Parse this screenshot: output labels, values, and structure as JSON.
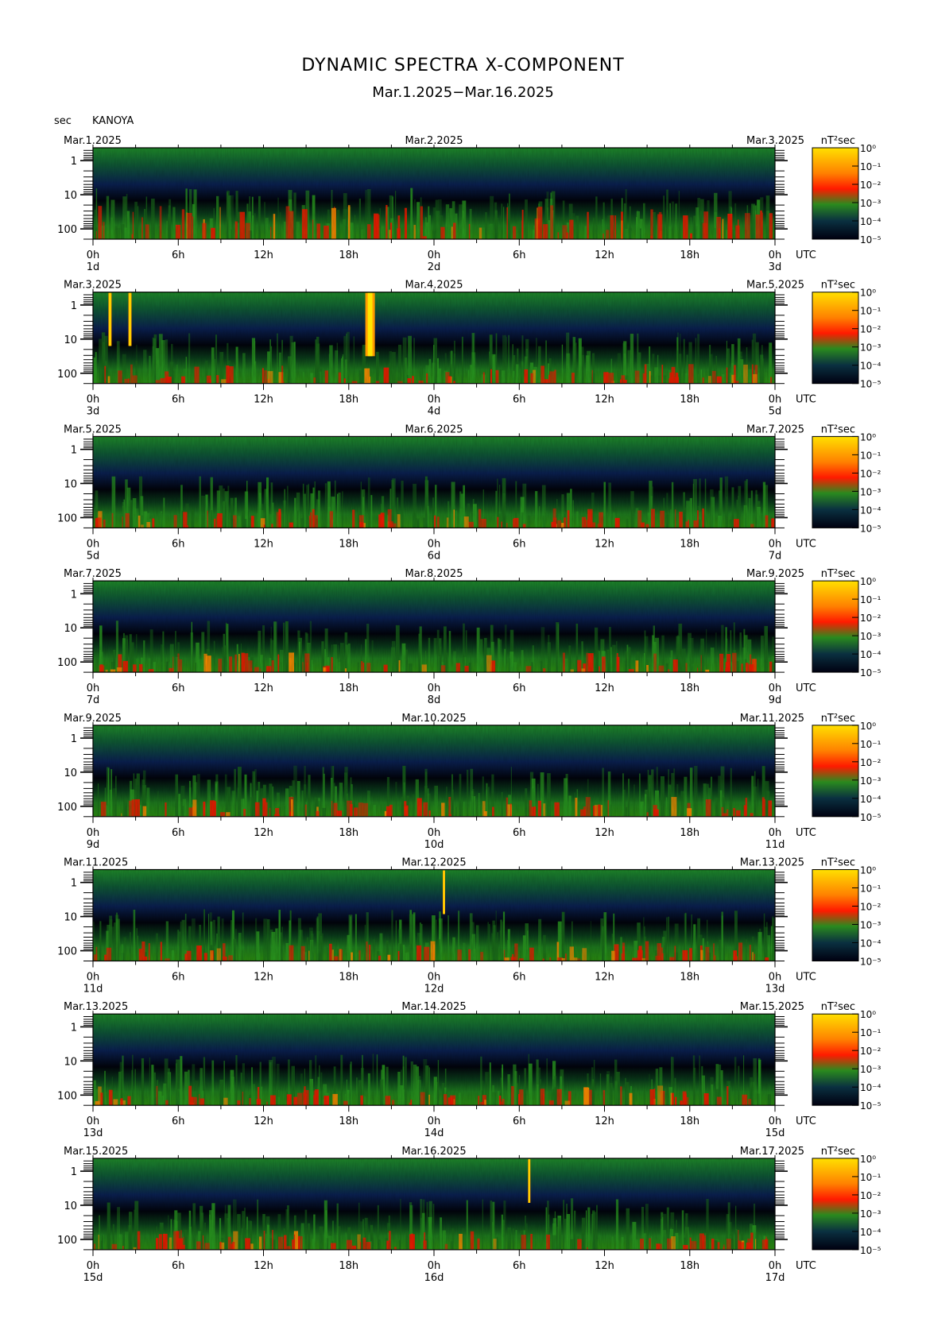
{
  "title": "DYNAMIC SPECTRA X-COMPONENT",
  "subtitle": "Mar.1.2025−Mar.16.2025",
  "station": "KANOYA",
  "y_unit": "sec",
  "chart_data": {
    "type": "heatmap",
    "x_unit": "UTC",
    "colorbar_unit": "nT²sec",
    "colorbar_ticks": [
      "10⁰",
      "10⁻¹",
      "10⁻²",
      "10⁻³",
      "10⁻⁴",
      "10⁻⁵"
    ],
    "x_ticks": [
      "0h",
      "6h",
      "12h",
      "18h",
      "0h",
      "6h",
      "12h",
      "18h",
      "0h"
    ],
    "y_ticks": [
      "1",
      "10",
      "100"
    ],
    "y_scale": "log",
    "panels": [
      {
        "start_label": "Mar.1.2025",
        "mid_label": "Mar.2.2025",
        "end_label": "Mar.3.2025",
        "day_labels": [
          "1d",
          "2d",
          "3d"
        ]
      },
      {
        "start_label": "Mar.3.2025",
        "mid_label": "Mar.4.2025",
        "end_label": "Mar.5.2025",
        "day_labels": [
          "3d",
          "4d",
          "5d"
        ]
      },
      {
        "start_label": "Mar.5.2025",
        "mid_label": "Mar.6.2025",
        "end_label": "Mar.7.2025",
        "day_labels": [
          "5d",
          "6d",
          "7d"
        ]
      },
      {
        "start_label": "Mar.7.2025",
        "mid_label": "Mar.8.2025",
        "end_label": "Mar.9.2025",
        "day_labels": [
          "7d",
          "8d",
          "9d"
        ]
      },
      {
        "start_label": "Mar.9.2025",
        "mid_label": "Mar.10.2025",
        "end_label": "Mar.11.2025",
        "day_labels": [
          "9d",
          "10d",
          "11d"
        ]
      },
      {
        "start_label": "Mar.11.2025",
        "mid_label": "Mar.12.2025",
        "end_label": "Mar.13.2025",
        "day_labels": [
          "11d",
          "12d",
          "13d"
        ]
      },
      {
        "start_label": "Mar.13.2025",
        "mid_label": "Mar.14.2025",
        "end_label": "Mar.15.2025",
        "day_labels": [
          "13d",
          "14d",
          "15d"
        ]
      },
      {
        "start_label": "Mar.15.2025",
        "mid_label": "Mar.16.2025",
        "end_label": "Mar.17.2025",
        "day_labels": [
          "15d",
          "16d",
          "17d"
        ]
      }
    ],
    "colors": {
      "very_high": "#ffe000",
      "high": "#ff2000",
      "mid": "#1e8a1e",
      "low": "#0a1a3a",
      "very_low": "#000008"
    }
  }
}
